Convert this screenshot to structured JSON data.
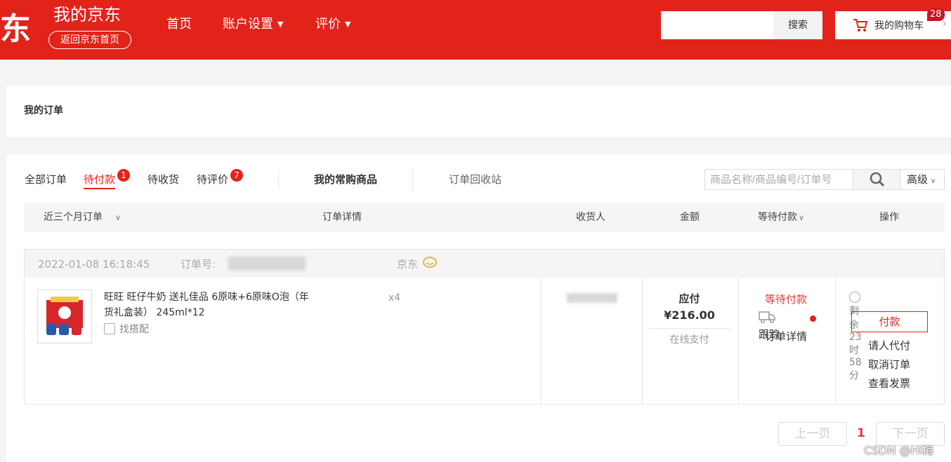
{
  "header": {
    "logo_text": "东",
    "title": "我的京东",
    "back_home": "返回京东首页",
    "nav": [
      {
        "label": "首页",
        "has_caret": false
      },
      {
        "label": "账户设置",
        "has_caret": true
      },
      {
        "label": "评价",
        "has_caret": true
      }
    ],
    "search_button": "搜索",
    "cart_label": "我的购物车",
    "cart_count": "28",
    "accent_color": "#e2231a"
  },
  "page_title": "我的订单",
  "tabs": [
    {
      "label": "全部订单",
      "badge": null,
      "active": false
    },
    {
      "label": "待付款",
      "badge": "1",
      "active": true
    },
    {
      "label": "待收货",
      "badge": null,
      "active": false
    },
    {
      "label": "待评价",
      "badge": "7",
      "active": false
    },
    {
      "label": "我的常购商品",
      "badge": null,
      "active": false
    },
    {
      "label": "订单回收站",
      "badge": null,
      "active": false
    }
  ],
  "order_search": {
    "placeholder": "商品名称/商品编号/订单号",
    "advanced_label": "高级"
  },
  "table_headers": {
    "period": "近三个月订单",
    "details": "订单详情",
    "receiver": "收货人",
    "amount": "金额",
    "status": "等待付款",
    "actions": "操作"
  },
  "order": {
    "datetime": "2022-01-08 16:18:45",
    "order_no_label": "订单号:",
    "shop": "京东",
    "product_name": "旺旺 旺仔牛奶 送礼佳品 6原味+6原味O泡（年货礼盒装） 245ml*12",
    "quantity": "x4",
    "find_match": "找搭配",
    "amount_label": "应付",
    "amount": "¥216.00",
    "pay_method": "在线支付",
    "status": "等待付款",
    "track": "跟踪",
    "detail_link": "订单详情",
    "remaining": "剩余23时58分",
    "pay_button": "付款",
    "ask_pay": "请人代付",
    "cancel": "取消订单",
    "invoice": "查看发票"
  },
  "pagination": {
    "prev": "上一页",
    "current": "1",
    "next": "下一页"
  },
  "watermark": "CSDN @Hi梅"
}
